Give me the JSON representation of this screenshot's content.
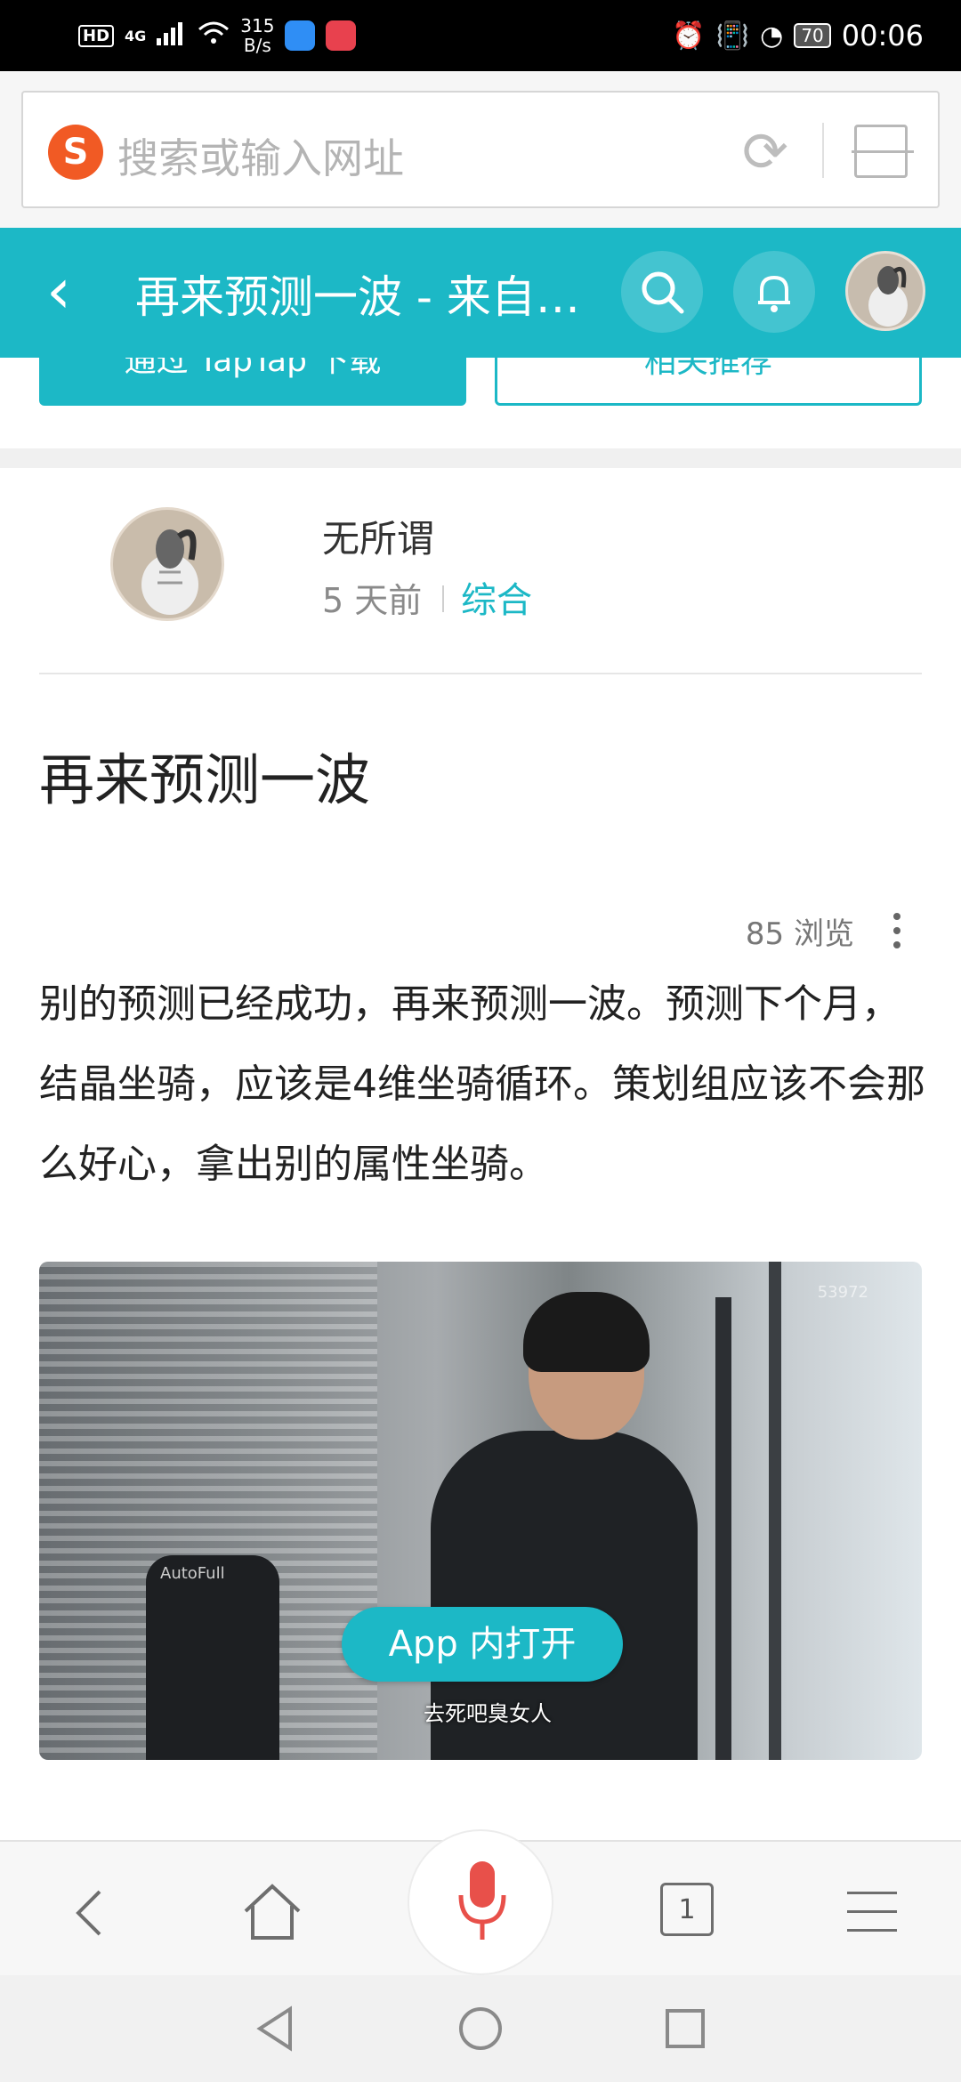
{
  "status_bar": {
    "hd": "HD",
    "network": "4G",
    "speed_value": "315",
    "speed_unit": "B/s",
    "battery": "70",
    "time": "00:06"
  },
  "browser": {
    "search_placeholder": "搜索或输入网址",
    "logo_letter": "S"
  },
  "header": {
    "title": "再来预测一波 - 来自…"
  },
  "actions": {
    "download_label": "通过 TapTap 下载",
    "related_label": "相关推荐"
  },
  "author": {
    "name": "无所谓",
    "time": "5 天前",
    "category": "综合"
  },
  "post": {
    "title": "再来预测一波",
    "views": "85 浏览",
    "body": "别的预测已经成功，再来预测一波。预测下个月，结晶坐骑，应该是4维坐骑循环。策划组应该不会那么好心，拿出别的属性坐骑。"
  },
  "media": {
    "caption": "去死吧臭女人",
    "chair_brand": "AutoFull",
    "watermark": "53972",
    "open_app_label": "App 内打开"
  },
  "bottom_bar": {
    "tab_count": "1"
  },
  "colors": {
    "accent": "#1cb8c6",
    "browser_logo": "#f15a24",
    "mic": "#e8504a"
  }
}
